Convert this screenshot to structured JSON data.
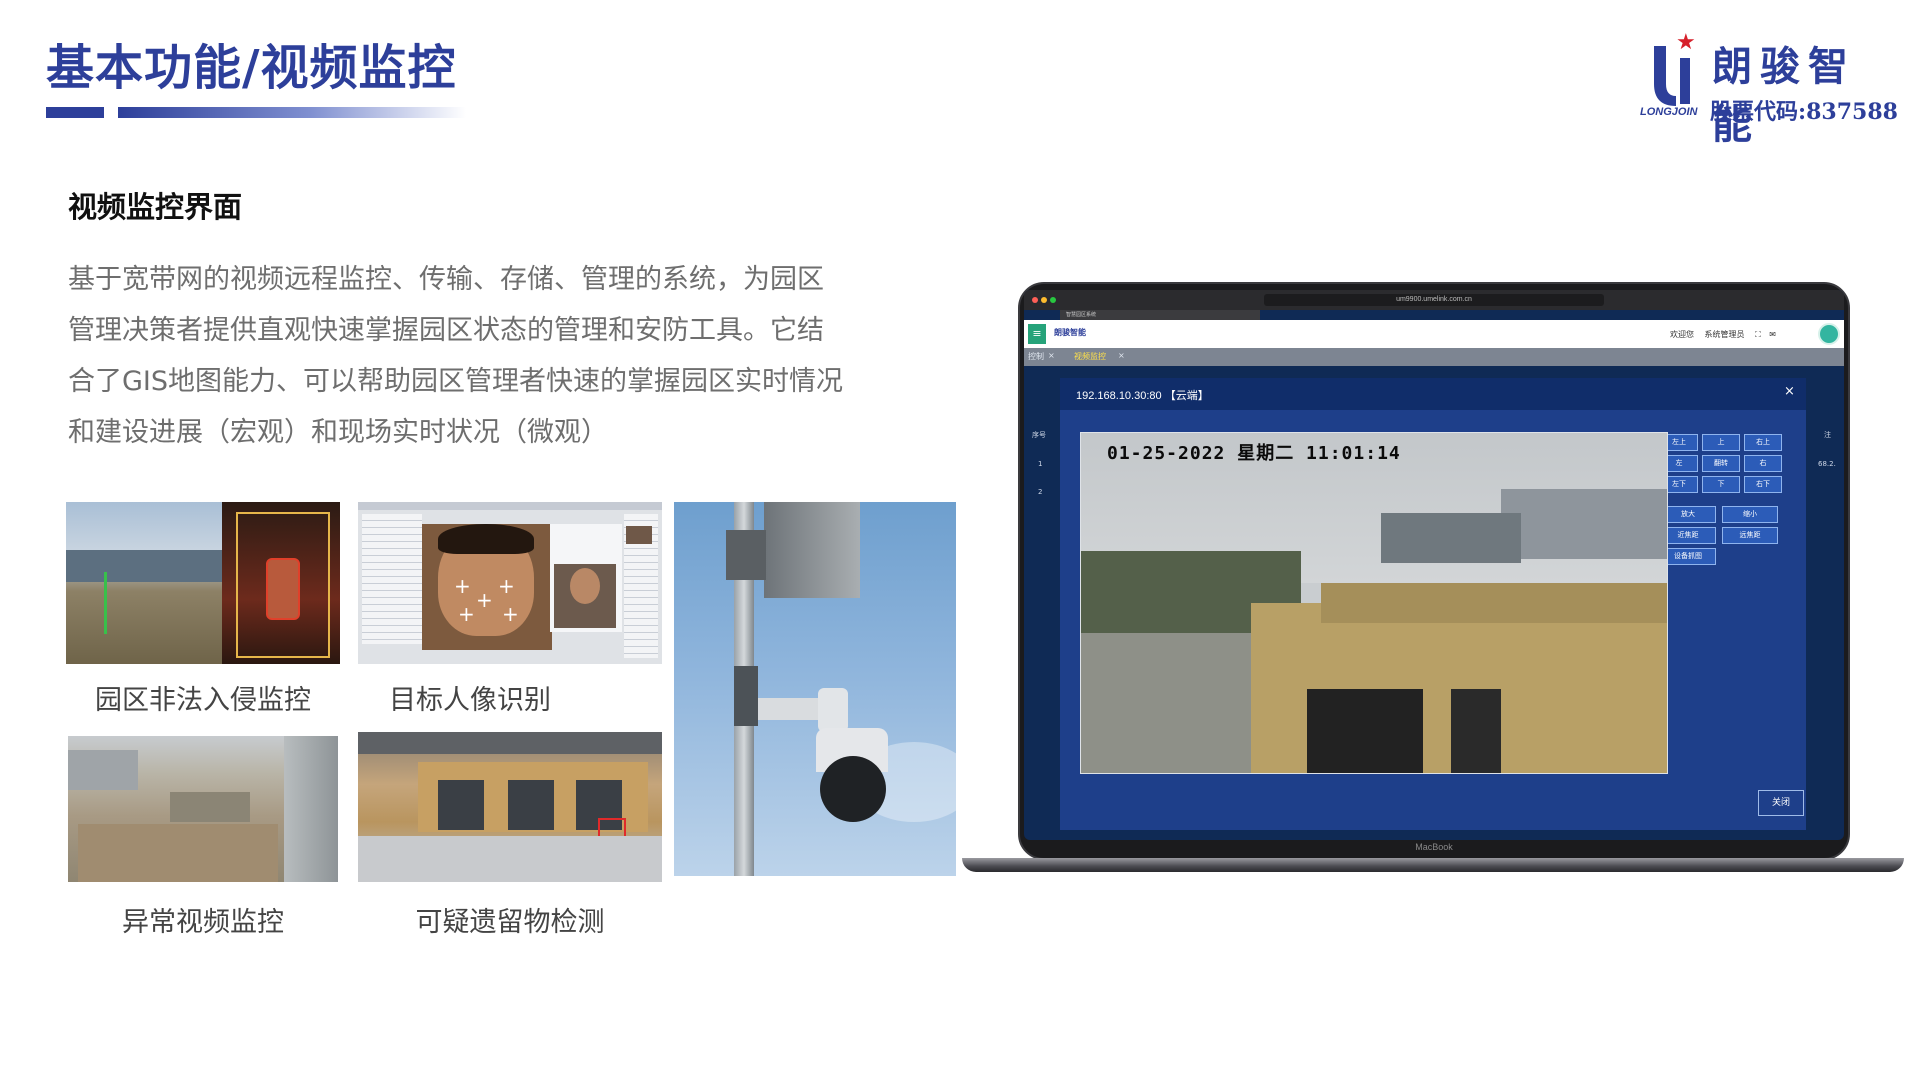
{
  "header": {
    "title": "基本功能/视频监控",
    "logo_name": "朗骏智能",
    "logo_en": "LONGJOIN",
    "stock_code": "股票代码:837588"
  },
  "section": {
    "heading": "视频监控界面",
    "lines": [
      "基于宽带网的视频远程监控、传输、存储、管理的系统，为园区",
      "管理决策者提供直观快速掌握园区状态的管理和安防工具。它结",
      "合了GIS地图能力、可以帮助园区管理者快速的掌握园区实时情况",
      "和建设进展（宏观）和现场实时状况（微观）"
    ]
  },
  "captions": {
    "intrusion": "园区非法入侵监控",
    "face": "目标人像识别",
    "abnormal": "异常视频监控",
    "left_object": "可疑遗留物检测"
  },
  "laptop": {
    "brand": "MacBook",
    "url": "um9900.umelink.com.cn",
    "browser_tab": "智慧园区系统",
    "app_logo": "朗骏智能",
    "user_welcome": "欢迎您",
    "user_role": "系统管理员",
    "tabs": [
      "控制",
      "视频监控"
    ],
    "dialog_title": "192.168.10.30:80 【云端】",
    "dialog_close": "×",
    "cam_overlay": "01-25-2022 星期二 11:01:14",
    "side_header": "序号",
    "side_rows": [
      "1",
      "2"
    ],
    "side_right_header": "注",
    "side_right_value": "68.2.",
    "ptz": [
      "左上",
      "上",
      "右上",
      "左",
      "翻转",
      "右",
      "左下",
      "下",
      "右下"
    ],
    "zoom": [
      "放大",
      "缩小",
      "近焦距",
      "远焦距",
      "设备抓图"
    ],
    "close_button": "关闭"
  },
  "colors": {
    "brand": "#2d3f9a",
    "accent_red": "#d6202a",
    "dialog_bg": "#1e3f8a",
    "app_green": "#26a37a"
  }
}
